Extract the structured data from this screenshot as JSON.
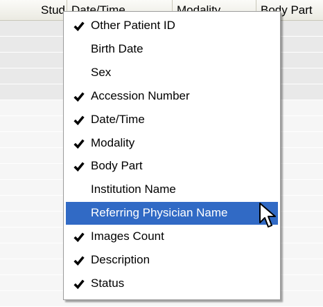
{
  "grid": {
    "columns": [
      {
        "label": "Stud"
      },
      {
        "label": "Date/Time"
      },
      {
        "label": "Modality"
      },
      {
        "label": "Body Part"
      }
    ]
  },
  "context_menu": {
    "items": [
      {
        "label": "Other Patient ID",
        "checked": true
      },
      {
        "label": "Birth Date",
        "checked": false
      },
      {
        "label": "Sex",
        "checked": false
      },
      {
        "label": "Accession Number",
        "checked": true
      },
      {
        "label": "Date/Time",
        "checked": true
      },
      {
        "label": "Modality",
        "checked": true
      },
      {
        "label": "Body Part",
        "checked": true
      },
      {
        "label": "Institution Name",
        "checked": false
      },
      {
        "label": "Referring Physician Name",
        "checked": false,
        "highlighted": true
      },
      {
        "label": "Images Count",
        "checked": true
      },
      {
        "label": "Description",
        "checked": true
      },
      {
        "label": "Status",
        "checked": true
      }
    ]
  },
  "icons": {
    "check": "check-icon",
    "cursor": "mouse-pointer-icon"
  },
  "colors": {
    "highlight": "#316ac5",
    "header_bg": "#ebeae2",
    "row_shade": "#e9e9e9"
  }
}
